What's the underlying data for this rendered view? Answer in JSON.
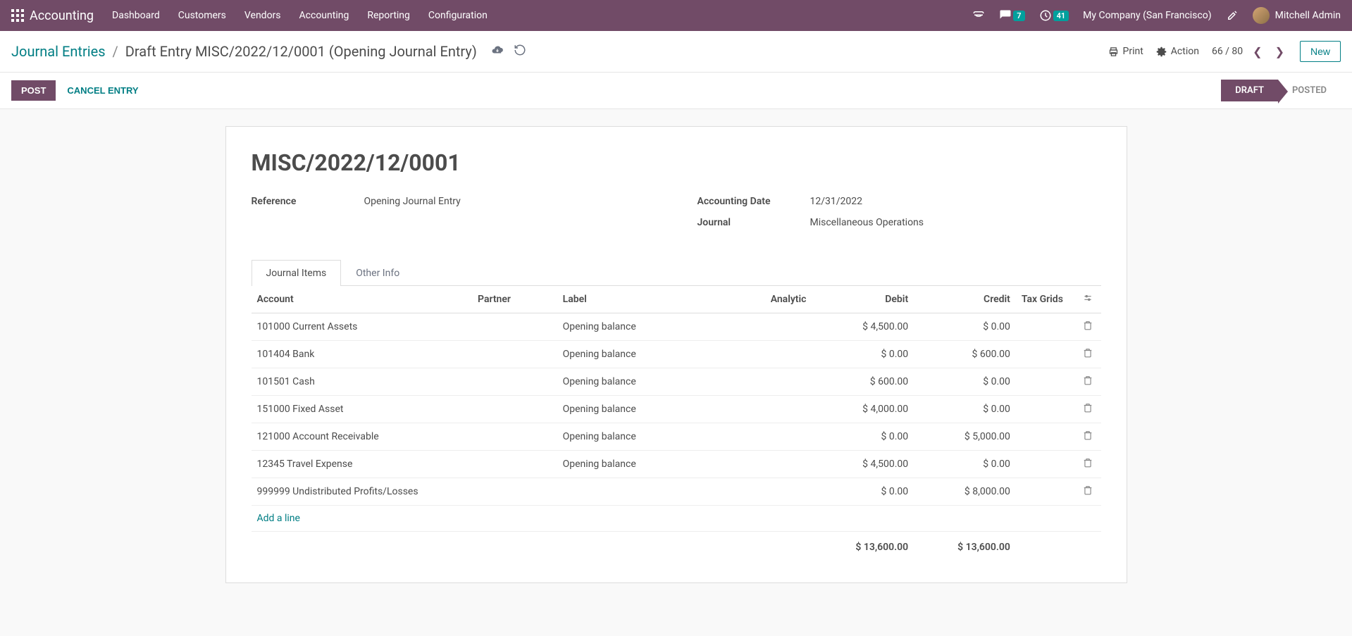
{
  "topbar": {
    "app_name": "Accounting",
    "menu": [
      "Dashboard",
      "Customers",
      "Vendors",
      "Accounting",
      "Reporting",
      "Configuration"
    ],
    "messages_badge": "7",
    "activities_badge": "41",
    "company": "My Company (San Francisco)",
    "user": "Mitchell Admin"
  },
  "header": {
    "breadcrumb_root": "Journal Entries",
    "breadcrumb_current": "Draft Entry MISC/2022/12/0001 (Opening Journal Entry)",
    "print": "Print",
    "action": "Action",
    "pager": "66 / 80",
    "new": "New"
  },
  "statusbar": {
    "post": "POST",
    "cancel": "CANCEL ENTRY",
    "draft": "DRAFT",
    "posted": "POSTED"
  },
  "record": {
    "name": "MISC/2022/12/0001",
    "ref_label": "Reference",
    "ref_value": "Opening Journal Entry",
    "date_label": "Accounting Date",
    "date_value": "12/31/2022",
    "journal_label": "Journal",
    "journal_value": "Miscellaneous Operations"
  },
  "tabs": {
    "items": "Journal Items",
    "other": "Other Info"
  },
  "table": {
    "headers": {
      "account": "Account",
      "partner": "Partner",
      "label": "Label",
      "analytic": "Analytic",
      "debit": "Debit",
      "credit": "Credit",
      "tax": "Tax Grids"
    },
    "rows": [
      {
        "account": "101000 Current Assets",
        "partner": "",
        "label": "Opening balance",
        "analytic": "",
        "debit": "$ 4,500.00",
        "credit": "$ 0.00"
      },
      {
        "account": "101404 Bank",
        "partner": "",
        "label": "Opening balance",
        "analytic": "",
        "debit": "$ 0.00",
        "credit": "$ 600.00"
      },
      {
        "account": "101501 Cash",
        "partner": "",
        "label": "Opening balance",
        "analytic": "",
        "debit": "$ 600.00",
        "credit": "$ 0.00"
      },
      {
        "account": "151000 Fixed Asset",
        "partner": "",
        "label": "Opening balance",
        "analytic": "",
        "debit": "$ 4,000.00",
        "credit": "$ 0.00"
      },
      {
        "account": "121000 Account Receivable",
        "partner": "",
        "label": "Opening balance",
        "analytic": "",
        "debit": "$ 0.00",
        "credit": "$ 5,000.00"
      },
      {
        "account": "12345 Travel Expense",
        "partner": "",
        "label": "Opening balance",
        "analytic": "",
        "debit": "$ 4,500.00",
        "credit": "$ 0.00"
      },
      {
        "account": "999999 Undistributed Profits/Losses",
        "partner": "",
        "label": "",
        "analytic": "",
        "debit": "$ 0.00",
        "credit": "$ 8,000.00"
      }
    ],
    "add_line": "Add a line",
    "total_debit": "$ 13,600.00",
    "total_credit": "$ 13,600.00"
  }
}
